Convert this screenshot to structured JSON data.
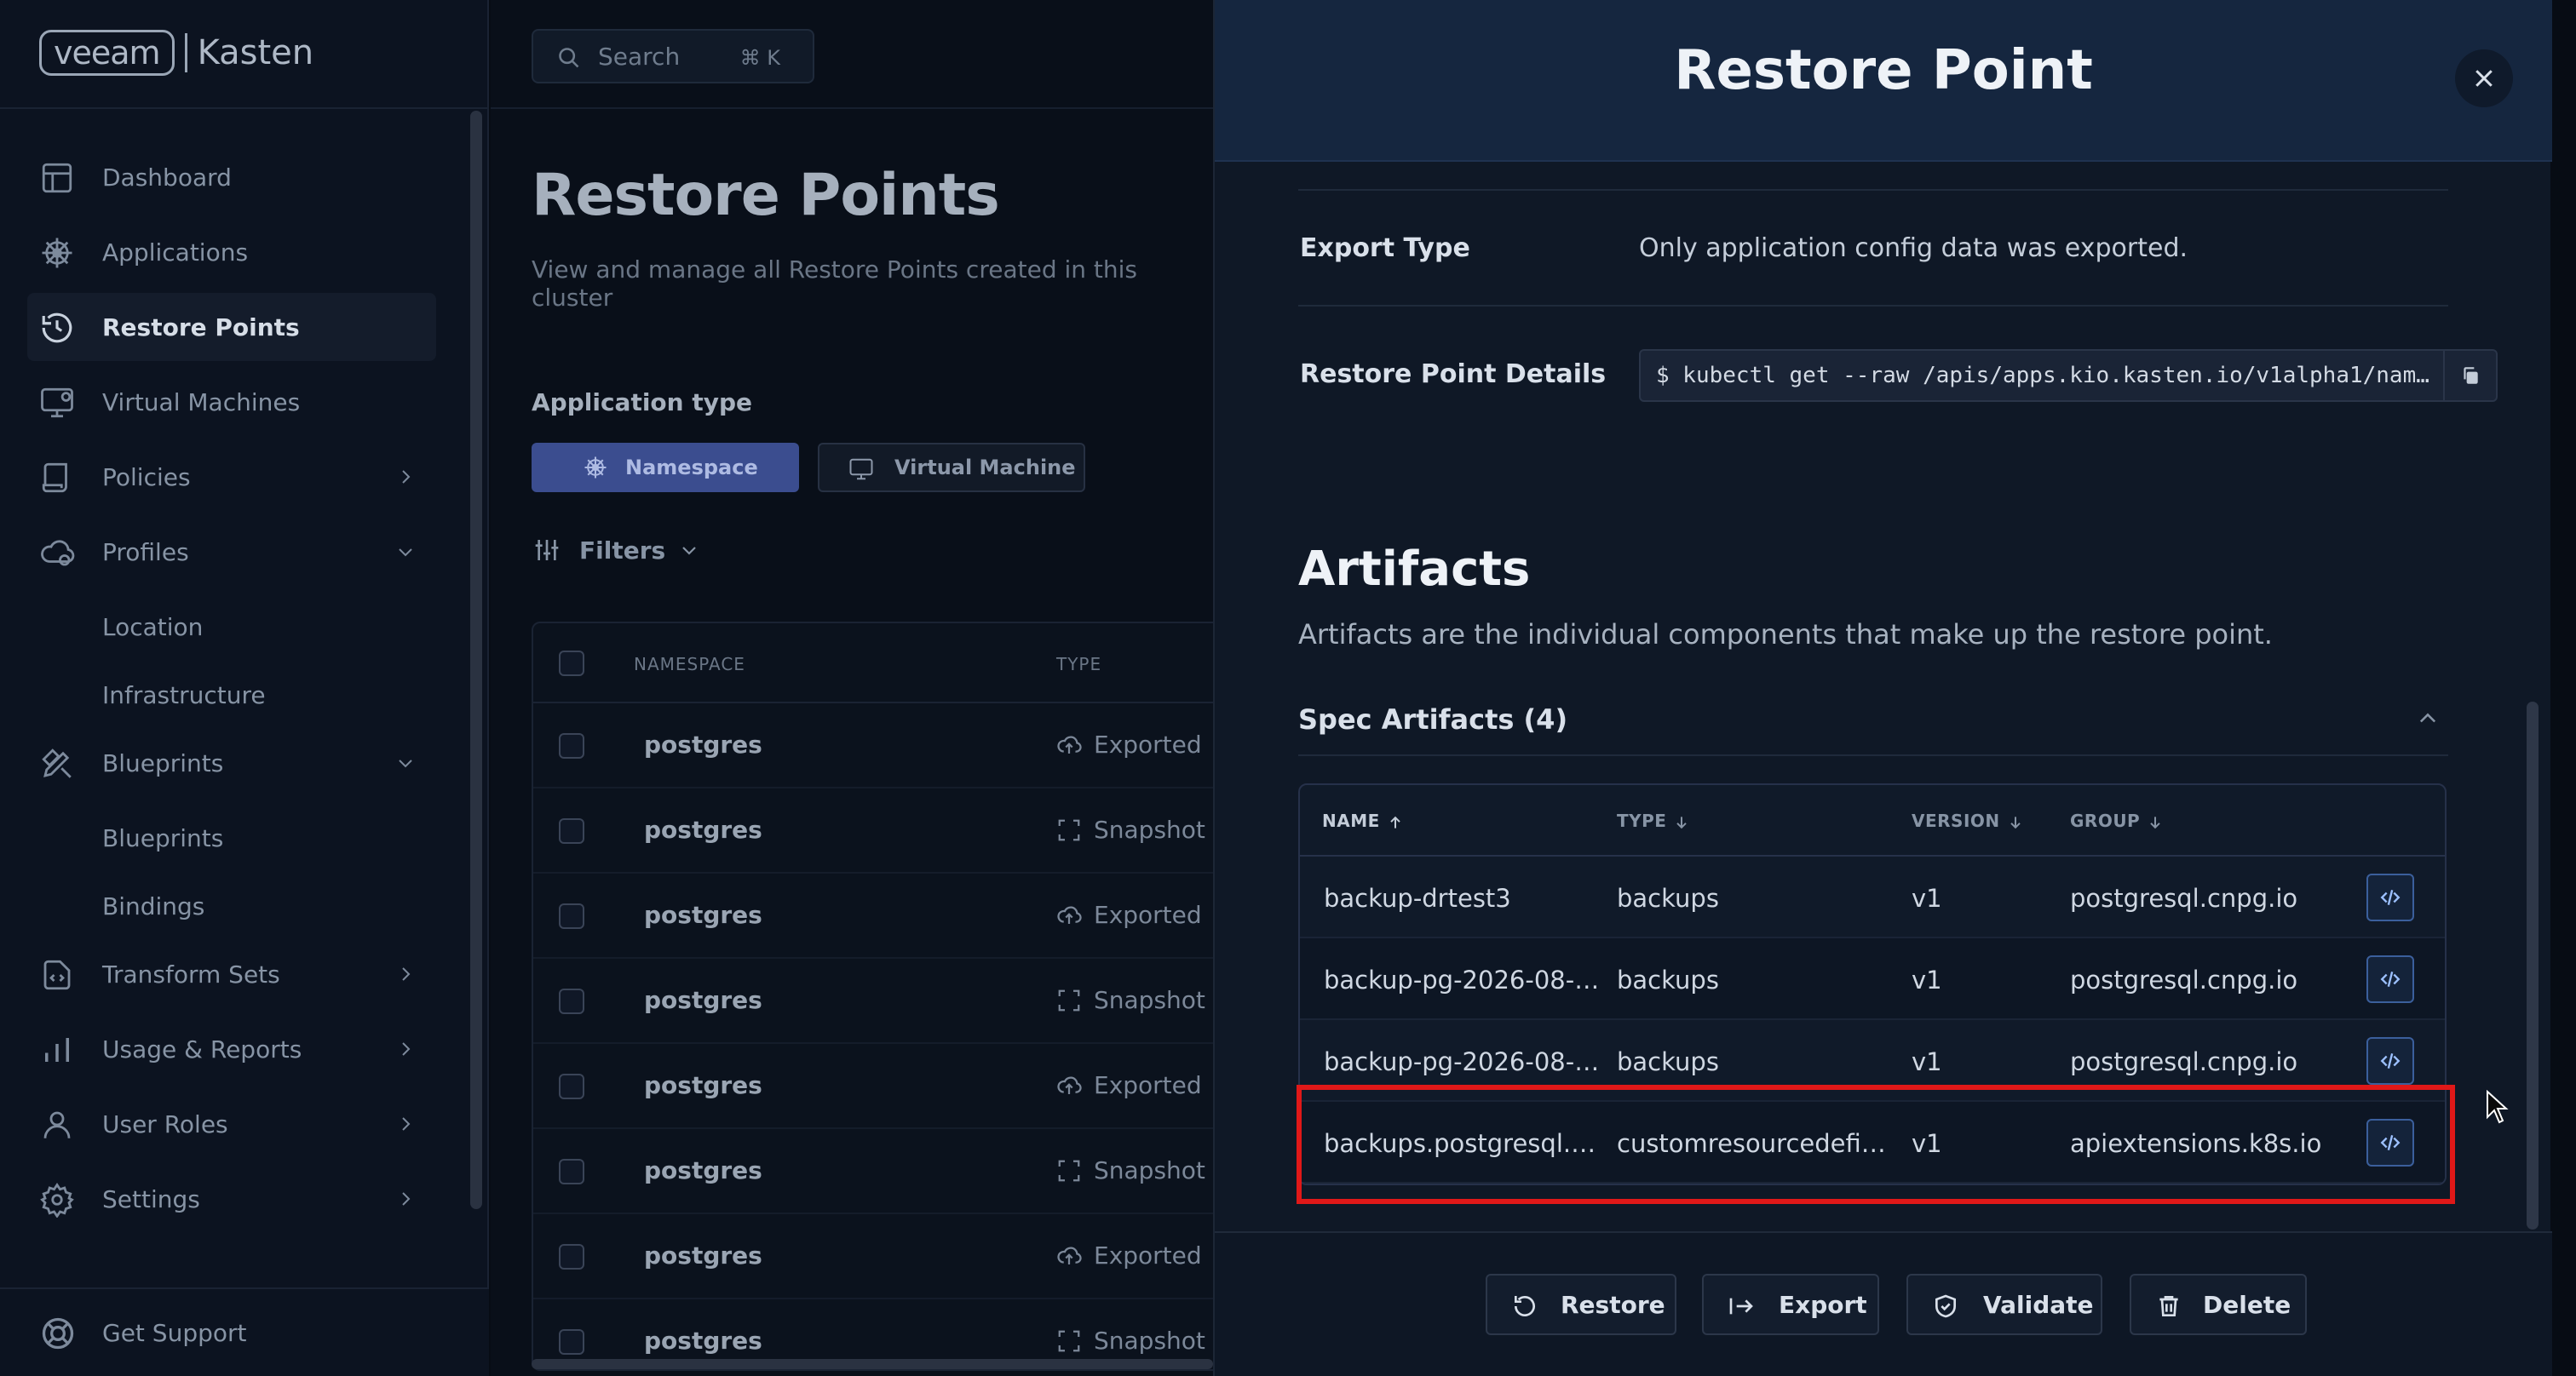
{
  "sidebar": {
    "logo_left": "veeam",
    "logo_right": "Kasten",
    "items": [
      {
        "label": "Dashboard",
        "icon": "dashboard-icon"
      },
      {
        "label": "Applications",
        "icon": "helm-wheel-icon"
      },
      {
        "label": "Restore Points",
        "icon": "history-icon",
        "active": true
      },
      {
        "label": "Virtual Machines",
        "icon": "monitor-icon"
      },
      {
        "label": "Policies",
        "icon": "scroll-icon",
        "chevron": "right"
      },
      {
        "label": "Profiles",
        "icon": "cloud-icon",
        "chevron": "down"
      },
      {
        "label": "Location",
        "sub": true
      },
      {
        "label": "Infrastructure",
        "sub": true
      },
      {
        "label": "Blueprints",
        "icon": "pencil-ruler-icon",
        "chevron": "down"
      },
      {
        "label": "Blueprints",
        "sub": true
      },
      {
        "label": "Bindings",
        "sub": true
      },
      {
        "label": "Transform Sets",
        "icon": "file-code-icon",
        "chevron": "right"
      },
      {
        "label": "Usage & Reports",
        "icon": "bar-chart-icon",
        "chevron": "right"
      },
      {
        "label": "User Roles",
        "icon": "user-icon",
        "chevron": "right"
      },
      {
        "label": "Settings",
        "icon": "gear-icon",
        "chevron": "right"
      }
    ],
    "support_label": "Get Support"
  },
  "main": {
    "search_placeholder": "Search",
    "search_shortcut": "⌘ K",
    "title": "Restore Points",
    "subtitle": "View and manage all Restore Points created in this cluster",
    "app_type_label": "Application type",
    "type_buttons": [
      "Namespace",
      "Virtual Machine"
    ],
    "filters_label": "Filters",
    "table": {
      "columns": [
        "NAMESPACE",
        "TYPE"
      ],
      "rows": [
        {
          "namespace": "postgres",
          "type": "Exported"
        },
        {
          "namespace": "postgres",
          "type": "Snapshot"
        },
        {
          "namespace": "postgres",
          "type": "Exported"
        },
        {
          "namespace": "postgres",
          "type": "Snapshot"
        },
        {
          "namespace": "postgres",
          "type": "Exported"
        },
        {
          "namespace": "postgres",
          "type": "Snapshot"
        },
        {
          "namespace": "postgres",
          "type": "Exported"
        },
        {
          "namespace": "postgres",
          "type": "Snapshot"
        }
      ]
    }
  },
  "panel": {
    "title": "Restore Point",
    "export_type_label": "Export Type",
    "export_type_value": "Only application config data was exported.",
    "details_label": "Restore Point Details",
    "details_command": "$ kubectl get --raw /apis/apps.kio.kasten.io/v1alpha1/nam…",
    "artifacts_title": "Artifacts",
    "artifacts_subtitle": "Artifacts are the individual components that make up the restore point.",
    "spec_artifacts_label": "Spec Artifacts  (4)",
    "artifact_columns": {
      "name": "NAME",
      "type": "TYPE",
      "version": "VERSION",
      "group": "GROUP"
    },
    "artifacts": [
      {
        "name": "backup-drtest3",
        "type": "backups",
        "version": "v1",
        "group": "postgresql.cnpg.io"
      },
      {
        "name": "backup-pg-2026-08-…",
        "type": "backups",
        "version": "v1",
        "group": "postgresql.cnpg.io"
      },
      {
        "name": "backup-pg-2026-08-…",
        "type": "backups",
        "version": "v1",
        "group": "postgresql.cnpg.io"
      },
      {
        "name": "backups.postgresql.…",
        "type": "customresourcedefi…",
        "version": "v1",
        "group": "apiextensions.k8s.io"
      }
    ],
    "footer_buttons": [
      "Restore",
      "Export",
      "Validate",
      "Delete"
    ]
  },
  "colors": {
    "accent": "#3b4d8f",
    "highlight": "#e01818",
    "panel_header": "#15263f"
  }
}
